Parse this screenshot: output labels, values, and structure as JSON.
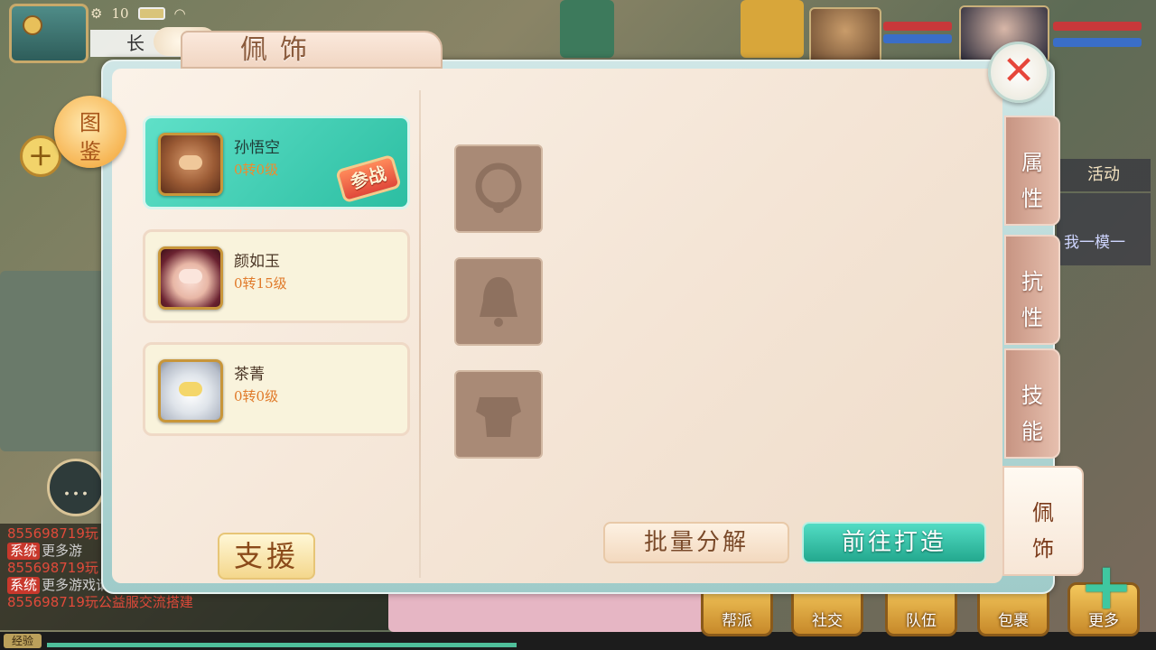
{
  "hud": {
    "signal_text": "10",
    "city_name": "长",
    "activity_label": "活动",
    "activity_sub": "我一模一"
  },
  "chat": {
    "lines": [
      {
        "tag": "",
        "text": "855698719玩"
      },
      {
        "tag": "系统",
        "text": "更多游"
      },
      {
        "tag": "",
        "text": "855698719玩"
      },
      {
        "tag": "系统",
        "text": "更多游戏请访问: www.ywtya.cn 加入Q群:"
      },
      {
        "tag": "",
        "text": "855698719玩公益服交流搭建"
      }
    ]
  },
  "exp_label": "经验",
  "bottom_menu": [
    "帮派",
    "社交",
    "队伍",
    "包裹",
    "更多"
  ],
  "panel": {
    "title": "佩饰",
    "tujian": [
      "图",
      "鉴"
    ]
  },
  "characters": [
    {
      "name": "孙悟空",
      "level": "0转0级",
      "badge": "参战"
    },
    {
      "name": "颜如玉",
      "level": "0转15级",
      "badge": ""
    },
    {
      "name": "茶菁",
      "level": "0转0级",
      "badge": ""
    }
  ],
  "slots": [
    "ring-slot-icon",
    "bell-slot-icon",
    "armor-slot-icon"
  ],
  "buttons": {
    "support": "支援",
    "decompose": "批量分解",
    "craft": "前往打造"
  },
  "tabs": [
    {
      "label": [
        "属",
        "性"
      ]
    },
    {
      "label": [
        "抗",
        "性"
      ]
    },
    {
      "label": [
        "技",
        "能"
      ]
    },
    {
      "label": [
        "佩",
        "饰"
      ]
    }
  ],
  "colors": {
    "accent_teal": "#2cbea2",
    "level_orange": "#e07a2a",
    "close_red": "#e6463b"
  }
}
